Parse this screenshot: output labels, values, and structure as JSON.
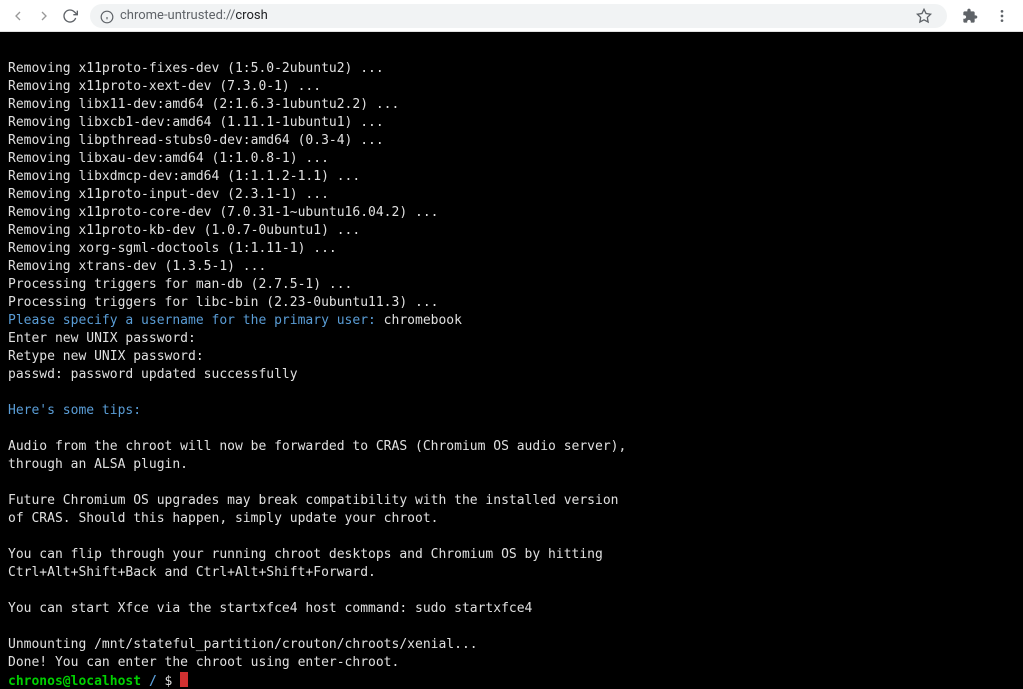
{
  "browser": {
    "url_host": "chrome-untrusted://",
    "url_path": "crosh"
  },
  "terminal": {
    "lines": [
      {
        "type": "plain",
        "text": "Removing x11proto-fixes-dev (1:5.0-2ubuntu2) ..."
      },
      {
        "type": "plain",
        "text": "Removing x11proto-xext-dev (7.3.0-1) ..."
      },
      {
        "type": "plain",
        "text": "Removing libx11-dev:amd64 (2:1.6.3-1ubuntu2.2) ..."
      },
      {
        "type": "plain",
        "text": "Removing libxcb1-dev:amd64 (1.11.1-1ubuntu1) ..."
      },
      {
        "type": "plain",
        "text": "Removing libpthread-stubs0-dev:amd64 (0.3-4) ..."
      },
      {
        "type": "plain",
        "text": "Removing libxau-dev:amd64 (1:1.0.8-1) ..."
      },
      {
        "type": "plain",
        "text": "Removing libxdmcp-dev:amd64 (1:1.1.2-1.1) ..."
      },
      {
        "type": "plain",
        "text": "Removing x11proto-input-dev (2.3.1-1) ..."
      },
      {
        "type": "plain",
        "text": "Removing x11proto-core-dev (7.0.31-1~ubuntu16.04.2) ..."
      },
      {
        "type": "plain",
        "text": "Removing x11proto-kb-dev (1.0.7-0ubuntu1) ..."
      },
      {
        "type": "plain",
        "text": "Removing xorg-sgml-doctools (1:1.11-1) ..."
      },
      {
        "type": "plain",
        "text": "Removing xtrans-dev (1.3.5-1) ..."
      },
      {
        "type": "plain",
        "text": "Processing triggers for man-db (2.7.5-1) ..."
      },
      {
        "type": "plain",
        "text": "Processing triggers for libc-bin (2.23-0ubuntu11.3) ..."
      },
      {
        "type": "mixed",
        "blue": "Please specify a username for the primary user:",
        "rest": " chromebook"
      },
      {
        "type": "plain",
        "text": "Enter new UNIX password:"
      },
      {
        "type": "plain",
        "text": "Retype new UNIX password:"
      },
      {
        "type": "plain",
        "text": "passwd: password updated successfully"
      },
      {
        "type": "plain",
        "text": ""
      },
      {
        "type": "blue",
        "text": "Here's some tips:"
      },
      {
        "type": "plain",
        "text": ""
      },
      {
        "type": "plain",
        "text": "Audio from the chroot will now be forwarded to CRAS (Chromium OS audio server),"
      },
      {
        "type": "plain",
        "text": "through an ALSA plugin."
      },
      {
        "type": "plain",
        "text": ""
      },
      {
        "type": "plain",
        "text": "Future Chromium OS upgrades may break compatibility with the installed version"
      },
      {
        "type": "plain",
        "text": "of CRAS. Should this happen, simply update your chroot."
      },
      {
        "type": "plain",
        "text": ""
      },
      {
        "type": "plain",
        "text": "You can flip through your running chroot desktops and Chromium OS by hitting"
      },
      {
        "type": "plain",
        "text": "Ctrl+Alt+Shift+Back and Ctrl+Alt+Shift+Forward."
      },
      {
        "type": "plain",
        "text": ""
      },
      {
        "type": "plain",
        "text": "You can start Xfce via the startxfce4 host command: sudo startxfce4"
      },
      {
        "type": "plain",
        "text": ""
      },
      {
        "type": "plain",
        "text": "Unmounting /mnt/stateful_partition/crouton/chroots/xenial..."
      },
      {
        "type": "plain",
        "text": "Done! You can enter the chroot using enter-chroot."
      }
    ],
    "prompt": {
      "user": "chronos@localhost",
      "path": "/",
      "symbol": "$"
    }
  }
}
